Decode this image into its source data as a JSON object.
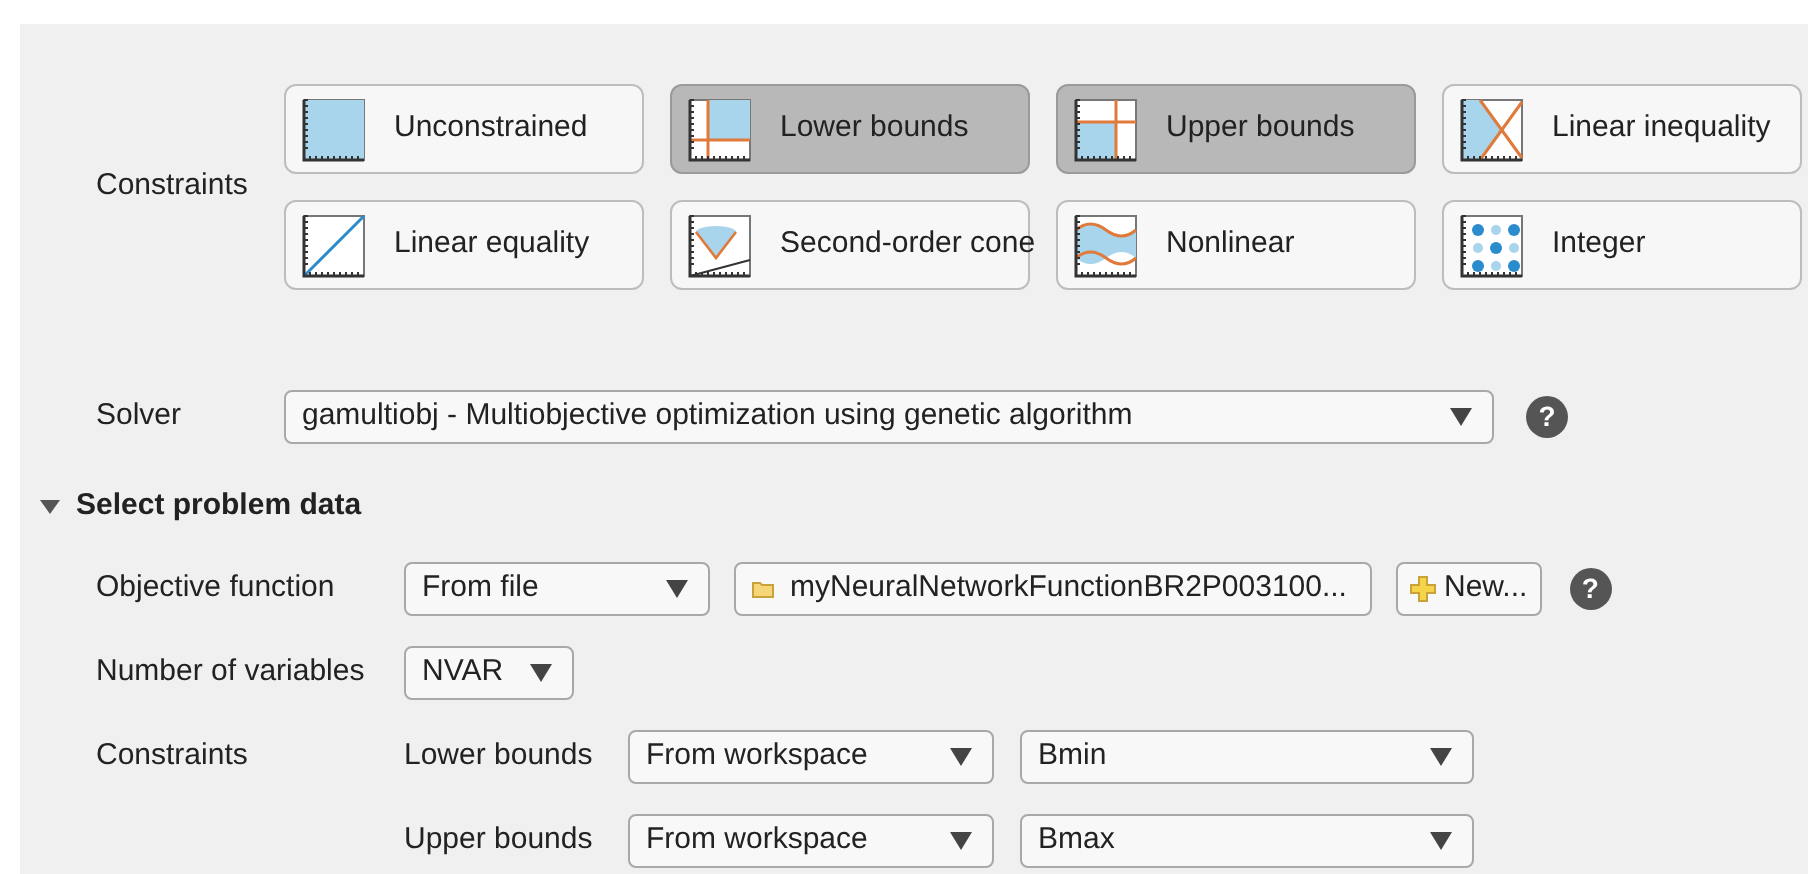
{
  "constraints": {
    "label": "Constraints",
    "buttons": [
      {
        "label": "Unconstrained",
        "kind": "unconstrained",
        "selected": false
      },
      {
        "label": "Lower bounds",
        "kind": "lower",
        "selected": true
      },
      {
        "label": "Upper bounds",
        "kind": "upper",
        "selected": true
      },
      {
        "label": "Linear inequality",
        "kind": "inequality",
        "selected": false
      },
      {
        "label": "Linear equality",
        "kind": "equality",
        "selected": false
      },
      {
        "label": "Second-order cone",
        "kind": "cone",
        "selected": false
      },
      {
        "label": "Nonlinear",
        "kind": "nonlinear",
        "selected": false
      },
      {
        "label": "Integer",
        "kind": "integer",
        "selected": false
      }
    ]
  },
  "solver": {
    "label": "Solver",
    "value": "gamultiobj - Multiobjective optimization using genetic algorithm",
    "help": "?"
  },
  "section": {
    "title": "Select problem data",
    "expanded": true
  },
  "objective": {
    "label": "Objective function",
    "source": "From file",
    "file": "myNeuralNetworkFunctionBR2P003100...",
    "new_button": "New...",
    "help": "?"
  },
  "variables": {
    "label": "Number of variables",
    "value": "NVAR"
  },
  "bounds": {
    "label": "Constraints",
    "rows": [
      {
        "label": "Lower bounds",
        "source": "From workspace",
        "value": "Bmin"
      },
      {
        "label": "Upper bounds",
        "source": "From workspace",
        "value": "Bmax"
      }
    ]
  }
}
